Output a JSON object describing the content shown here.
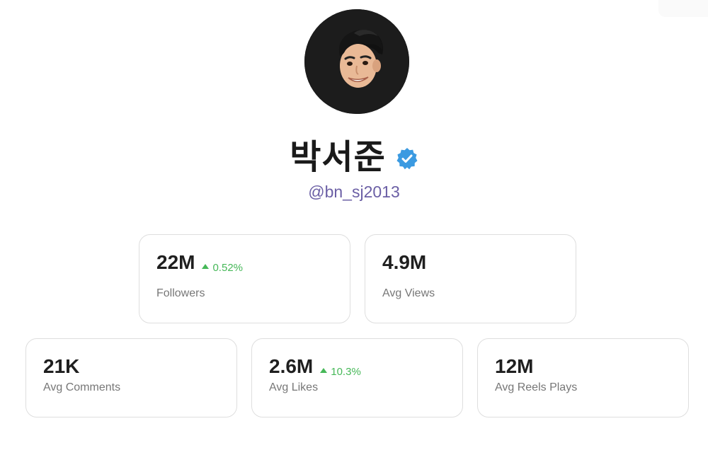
{
  "profile": {
    "name": "박서준",
    "handle": "@bn_sj2013",
    "verified_color": "#3b9ae1"
  },
  "stats": {
    "followers": {
      "value": "22M",
      "change": "0.52%",
      "label": "Followers"
    },
    "avg_views": {
      "value": "4.9M",
      "label": "Avg Views"
    },
    "avg_comments": {
      "value": "21K",
      "label": "Avg Comments"
    },
    "avg_likes": {
      "value": "2.6M",
      "change": "10.3%",
      "label": "Avg Likes"
    },
    "avg_reels_plays": {
      "value": "12M",
      "label": "Avg Reels Plays"
    }
  },
  "colors": {
    "positive_change": "#46b858",
    "handle": "#6b5fa5",
    "card_border": "#dedede"
  },
  "icons": {
    "verified": "verified-badge-icon",
    "change_up": "triangle-up-icon"
  }
}
